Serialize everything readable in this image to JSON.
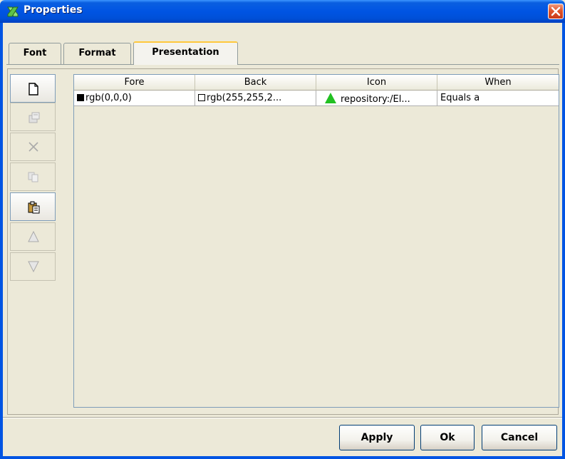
{
  "window": {
    "title": "Properties",
    "icon": "properties-app-icon",
    "close_icon": "close-icon"
  },
  "tabs": [
    {
      "label": "Font",
      "active": false
    },
    {
      "label": "Format",
      "active": false
    },
    {
      "label": "Presentation",
      "active": true
    }
  ],
  "toolbar": {
    "items": [
      {
        "icon": "new-document-icon",
        "enabled": true
      },
      {
        "icon": "properties-icon",
        "enabled": false
      },
      {
        "icon": "delete-icon",
        "enabled": false
      },
      {
        "icon": "copy-icon",
        "enabled": false
      },
      {
        "icon": "paste-icon",
        "enabled": true
      },
      {
        "icon": "move-up-icon",
        "enabled": false
      },
      {
        "icon": "move-down-icon",
        "enabled": false
      }
    ]
  },
  "table": {
    "columns": [
      "Fore",
      "Back",
      "Icon",
      "When"
    ],
    "rows": [
      {
        "fore": "rgb(0,0,0)",
        "back": "rgb(255,255,2...",
        "icon": "repository:/El...",
        "when": "Equals a"
      }
    ]
  },
  "buttons": {
    "apply": "Apply",
    "ok": "Ok",
    "cancel": "Cancel"
  },
  "colors": {
    "titlebar": "#0054e3",
    "tab_highlight": "#ffc83c",
    "close_button": "#e0542b",
    "icon_triangle": "#22c022"
  }
}
